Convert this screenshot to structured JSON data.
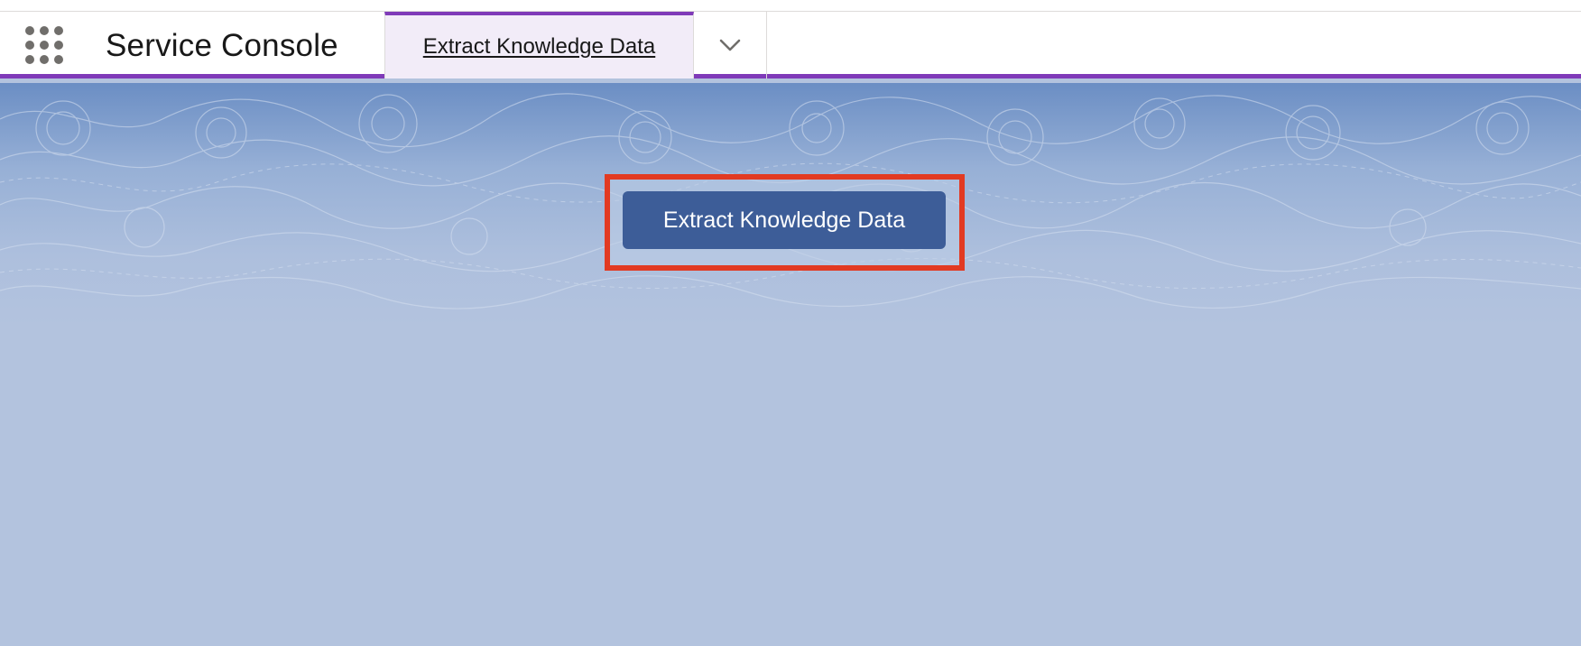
{
  "header": {
    "app_name": "Service Console",
    "active_tab": {
      "label": "Extract Knowledge Data"
    },
    "app_launcher_icon": "waffle-grid-icon",
    "tab_menu_icon": "chevron-down-icon"
  },
  "main": {
    "primary_button": {
      "label": "Extract Knowledge Data"
    }
  },
  "colors": {
    "accent": "#7f3ab8",
    "button": "#3d5d98",
    "highlight": "#e23a22",
    "background": "#b3c3de"
  }
}
